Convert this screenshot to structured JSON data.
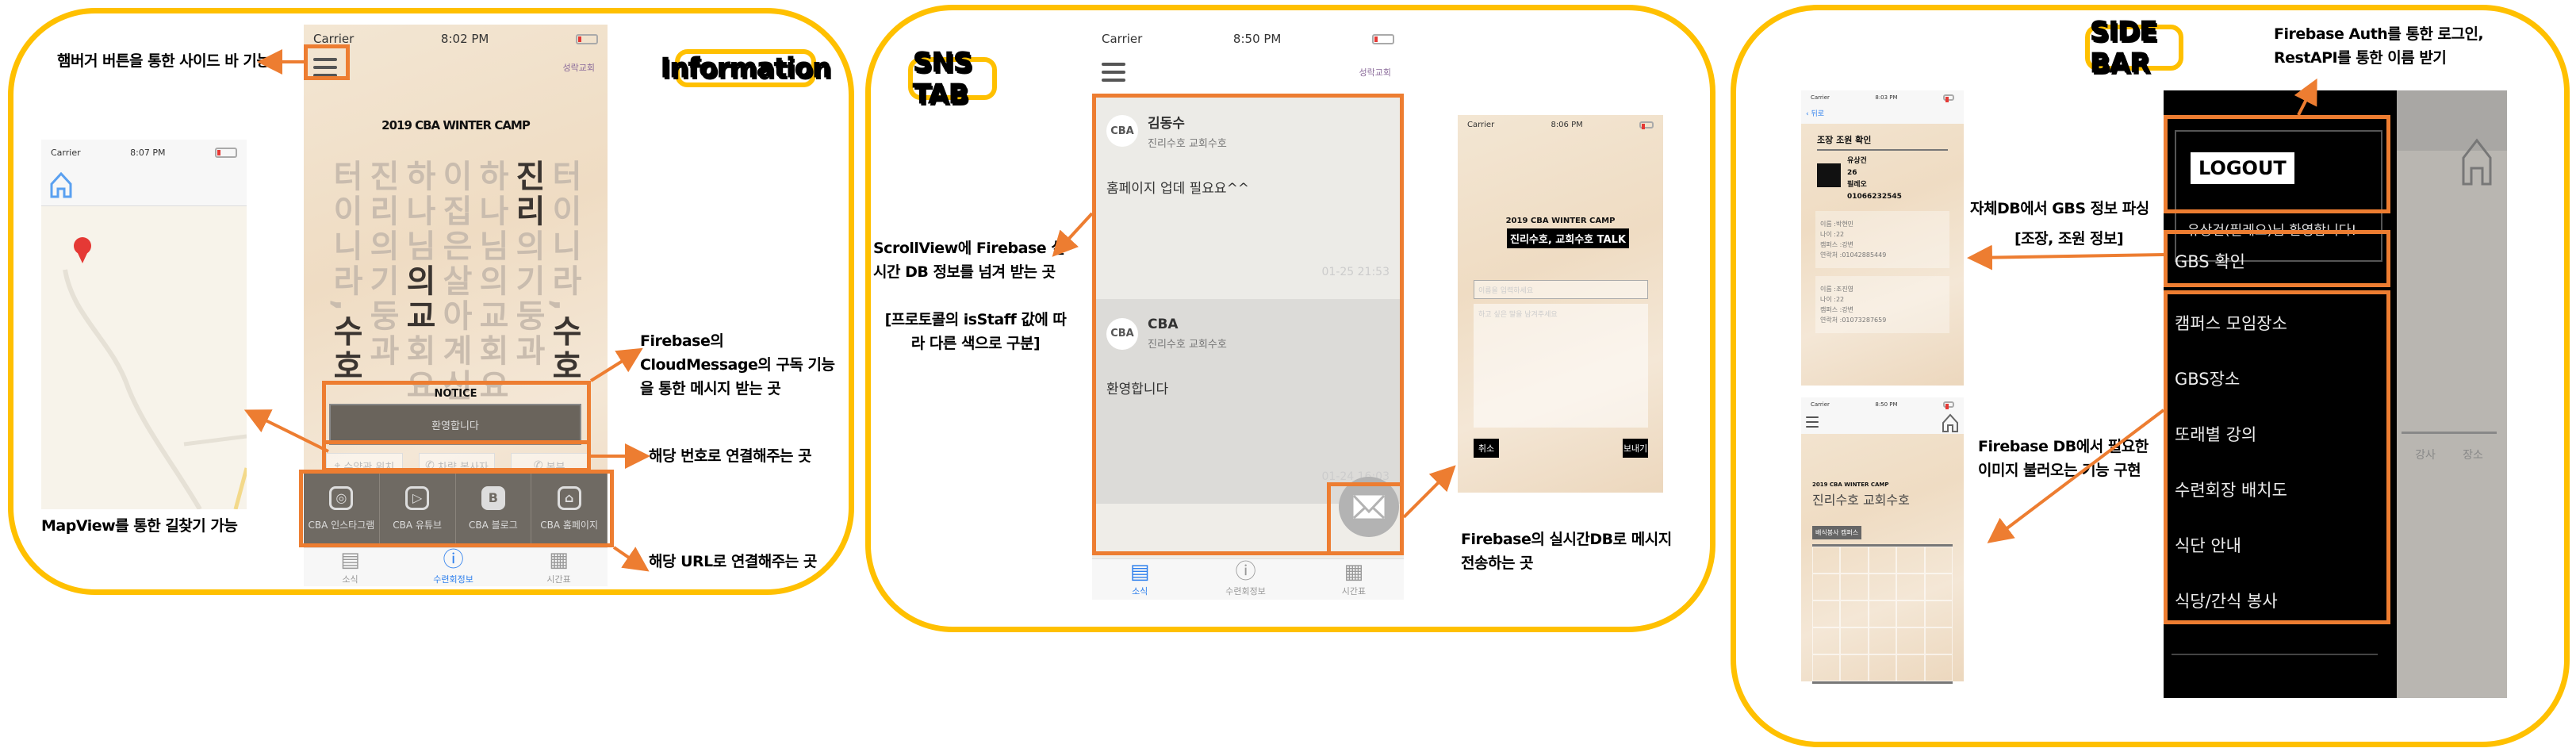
{
  "colors": {
    "panel_border": "#ffc000",
    "annotation": "#ed7d31",
    "tab_active": "#2f80ed"
  },
  "badges": {
    "information": "Information",
    "sns": "SNS TAB",
    "sidebar": "SIDE BAR"
  },
  "info": {
    "status": {
      "carrier": "Carrier",
      "time": "8:02 PM"
    },
    "logo": "성락교회",
    "camp_title": "2019 CBA WINTER CAMP",
    "columns": [
      "터이니라,수호",
      "진리의기둥과",
      "하나님의교회요",
      "이집은살아계신",
      "하나님의교회요",
      "진리의기둥과",
      "터이니라,수호"
    ],
    "notice_title": "NOTICE",
    "notice_text": "환영합니다",
    "phone_buttons": [
      "수양관 위치",
      "차량 봉사자",
      "본부"
    ],
    "links": [
      "CBA 인스타그램",
      "CBA 유튜브",
      "CBA 블로그",
      "CBA 홈페이지"
    ],
    "tabs": [
      "소식",
      "수련회정보",
      "시간표"
    ],
    "map": {
      "carrier": "Carrier",
      "time": "8:07 PM"
    },
    "notes": {
      "hamburger": "햄버거 버튼을 통한 사이드 바 기능",
      "mapview": "MapView를 통한 길찾기 가능",
      "cloud": "Firebase의 CloudMessage의 구독 기능을 통한 메시지 받는 곳",
      "phone": "해당 번호로 연결해주는 곳",
      "url": "해당 URL로 연결해주는 곳"
    }
  },
  "sns": {
    "status": {
      "carrier": "Carrier",
      "time": "8:50 PM"
    },
    "logo": "성락교회",
    "posts": [
      {
        "avatar": "CBA",
        "name": "김동수",
        "group": "진리수호 교회수호",
        "text": "홈페이지 업데 필요요^^",
        "time": "01-25 21:53"
      },
      {
        "avatar": "CBA",
        "name": "CBA",
        "group": "진리수호 교회수호",
        "text": "환영합니다",
        "time": "01-24 16:03"
      }
    ],
    "tabs": [
      "소식",
      "수련회정보",
      "시간표"
    ],
    "talk": {
      "time": "8:06 PM",
      "carrier": "Carrier",
      "camp": "2019 CBA WINTER CAMP",
      "title": "진리수호, 교회수호 TALK",
      "name_placeholder": "이름을 입력하세요",
      "msg_placeholder": "하고 싶은 말을 남겨주세요",
      "cancel": "취소",
      "send": "보내기"
    },
    "notes": {
      "scroll": "ScrollView에 Firebase 실시간 DB 정보를 넘겨 받는 곳",
      "staff": "[프로토콜의 isStaff 값에 따라 다른 색으로 구분]",
      "send": "Firebase의 실시간DB로 메시지 전송하는 곳"
    }
  },
  "sidebar": {
    "logout": "LOGOUT",
    "welcome": "유상건(필레오)님 환영합니다!",
    "gbs": "GBS 확인",
    "menu": [
      "캠퍼스 모임장소",
      "GBS장소",
      "또래별 강의",
      "수련회장 배치도",
      "식단 안내",
      "식당/간식 봉사"
    ],
    "bg_headers": [
      "강사",
      "장소"
    ],
    "gbs_phone": {
      "carrier": "Carrier",
      "time": "8:03 PM",
      "back": "뒤로",
      "title": "조장 조원 확인",
      "leader": [
        "유상건",
        "26",
        "필레오",
        "01066232545"
      ],
      "members": [
        [
          "이름 :박현민",
          "나이 :22",
          "캠퍼스 :강변",
          "연락처 :01042885449"
        ],
        [
          "이름 :조진영",
          "나이 :22",
          "캠퍼스 :강변",
          "연락처 :01073287659"
        ]
      ]
    },
    "img_phone": {
      "carrier": "Carrier",
      "time": "8:50 PM",
      "camp": "2019 CBA WINTER CAMP",
      "title": "진리수호 교회수호",
      "section": "배식봉사 캠퍼스"
    },
    "notes": {
      "auth": "Firebase Auth를 통한 로그인, RestAPI를 통한 이름 받기",
      "gbs": "자체DB에서 GBS 정보 파싱",
      "gbs2": "[조장, 조원 정보]",
      "image": "Firebase DB에서 필요한 이미지 불러오는 기능 구현"
    }
  }
}
